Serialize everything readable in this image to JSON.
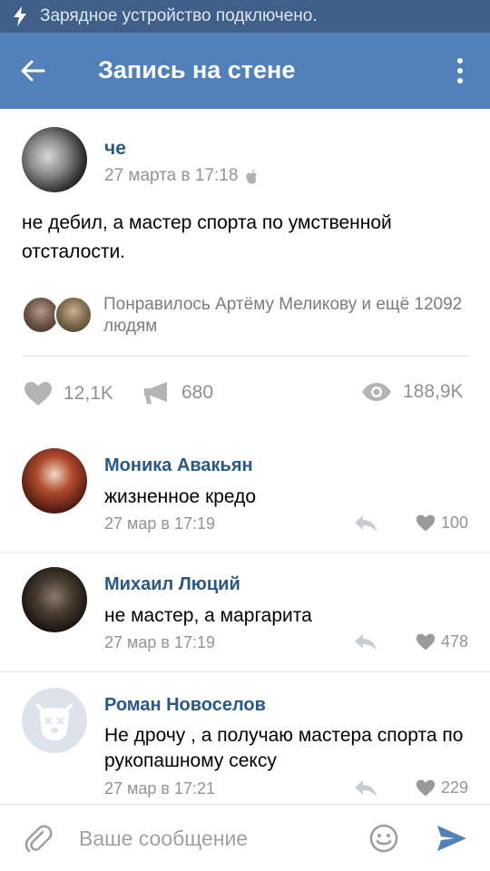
{
  "status_bar": {
    "text": "Зарядное устройство подключено."
  },
  "app_bar": {
    "title": "Запись на стене"
  },
  "post": {
    "author": "че",
    "date": "27 марта в 17:18",
    "text": "не дебил, а мастер спорта по умственной отсталости.",
    "likers_text": "Понравилось Артёму Меликову и ещё 12092 людям",
    "stats": {
      "likes": "12,1K",
      "reposts": "680",
      "views": "188,9K"
    }
  },
  "comments": [
    {
      "name": "Моника Авакьян",
      "text": "жизненное кредо",
      "date": "27 мар в 17:19",
      "likes": "100"
    },
    {
      "name": "Михаил Люций",
      "text": "не мастер, а маргарита",
      "date": "27 мар в 17:19",
      "likes": "478"
    },
    {
      "name": "Роман Новоселов",
      "text": "Не дрочу , а получаю мастера спорта по рукопашному сексу",
      "date": "27 мар в 17:21",
      "likes": "229"
    }
  ],
  "composer": {
    "placeholder": "Ваше сообщение"
  },
  "colors": {
    "status_bar": "#3f5f88",
    "app_bar": "#5181b8",
    "link": "#2a5885",
    "secondary": "#939393",
    "send": "#5181b8"
  }
}
